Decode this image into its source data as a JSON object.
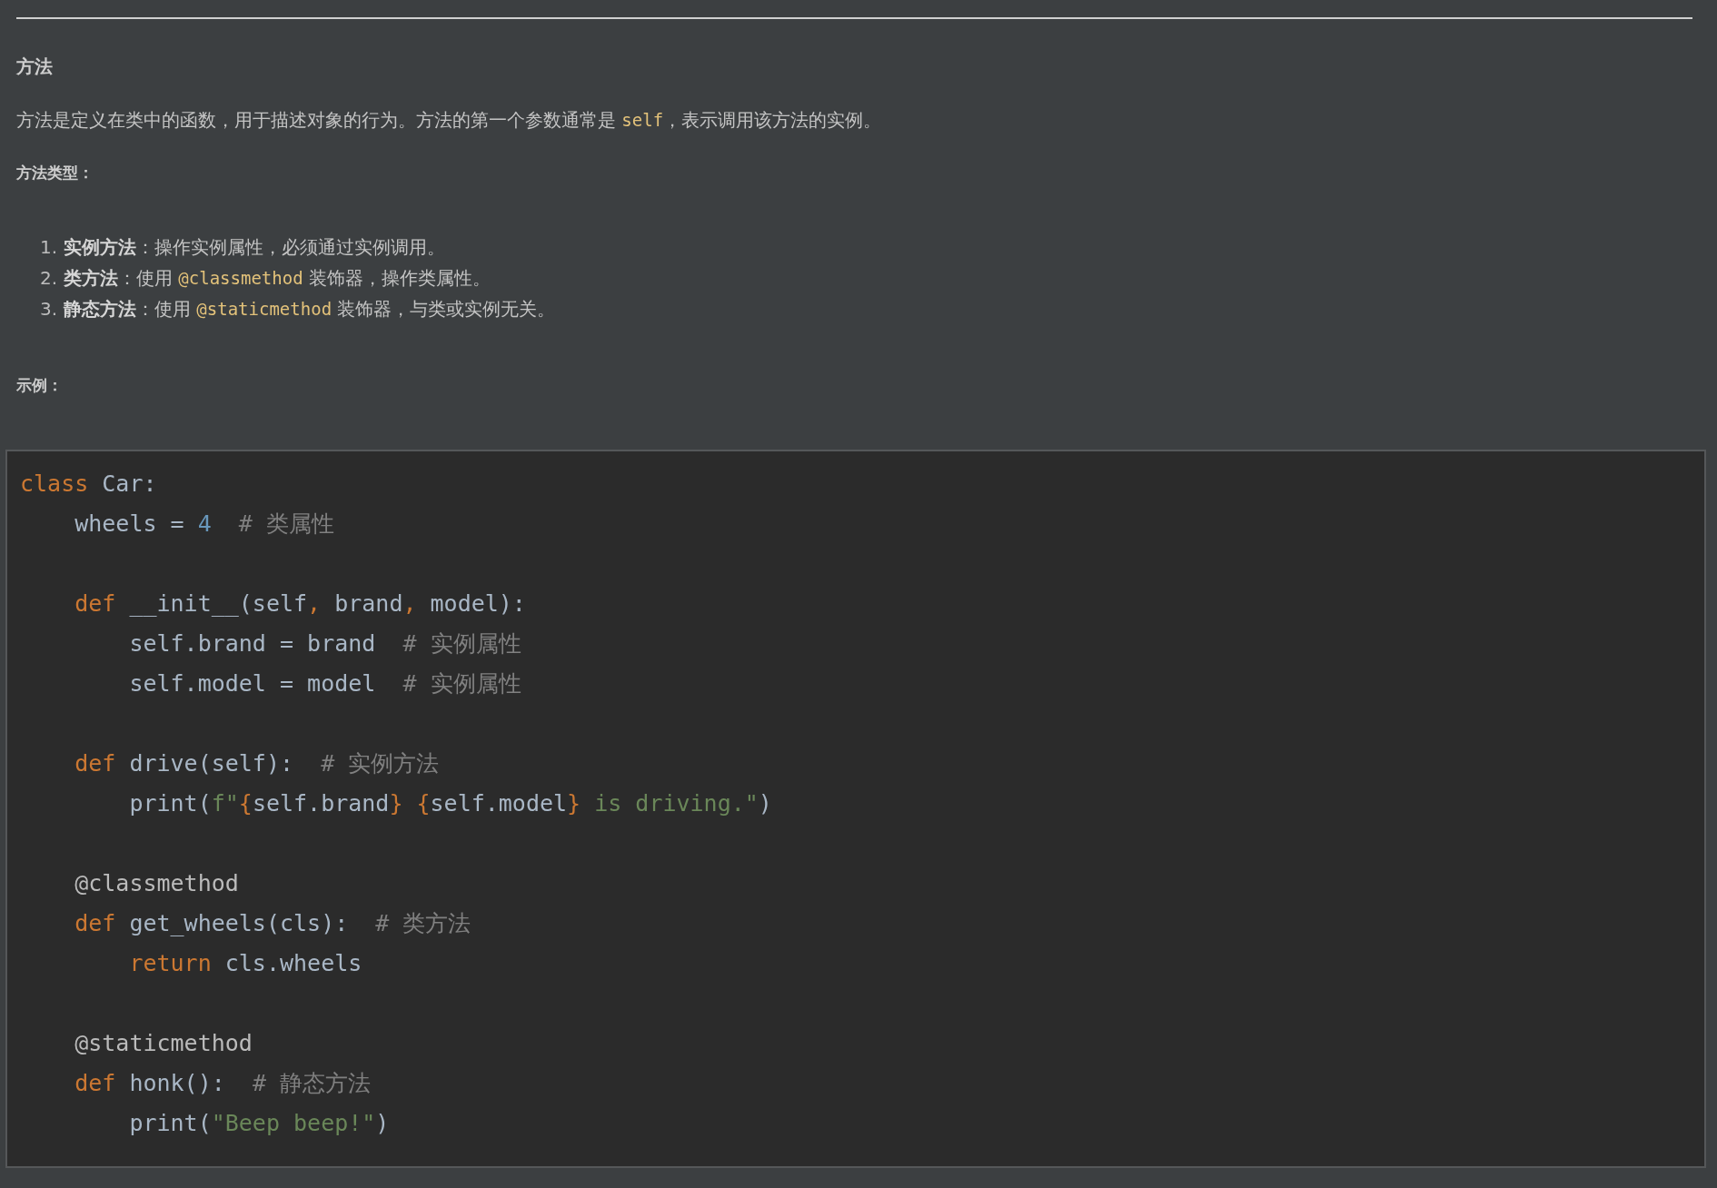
{
  "heading": "方法",
  "paragraph": [
    {
      "kind": "text",
      "text": "方法是定义在类中的函数，用于描述对象的行为。方法的第一个参数通常是 "
    },
    {
      "kind": "code",
      "text": "self"
    },
    {
      "kind": "text",
      "text": "，表示调用该方法的实例。"
    }
  ],
  "subheading": "方法类型：",
  "list": [
    {
      "number": "1.",
      "segments": [
        {
          "kind": "bold",
          "text": "实例方法"
        },
        {
          "kind": "text",
          "text": "：操作实例属性，必须通过实例调用。"
        }
      ]
    },
    {
      "number": "2.",
      "segments": [
        {
          "kind": "bold",
          "text": "类方法"
        },
        {
          "kind": "text",
          "text": "：使用 "
        },
        {
          "kind": "code",
          "text": "@classmethod"
        },
        {
          "kind": "text",
          "text": " 装饰器，操作类属性。"
        }
      ]
    },
    {
      "number": "3.",
      "segments": [
        {
          "kind": "bold",
          "text": "静态方法"
        },
        {
          "kind": "text",
          "text": "：使用 "
        },
        {
          "kind": "code",
          "text": "@staticmethod"
        },
        {
          "kind": "text",
          "text": " 装饰器，与类或实例无关。"
        }
      ]
    }
  ],
  "example_label": "示例：",
  "code_block": {
    "lines": [
      {
        "kind": "code",
        "tokens": [
          {
            "kind": "keyword",
            "text": "class"
          },
          {
            "kind": "plain",
            "text": " Car:"
          }
        ]
      },
      {
        "kind": "code",
        "tokens": [
          {
            "kind": "plain",
            "text": "    wheels = "
          },
          {
            "kind": "number",
            "text": "4"
          },
          {
            "kind": "comment",
            "text": "  # 类属性"
          }
        ]
      },
      {
        "kind": "blank"
      },
      {
        "kind": "code",
        "tokens": [
          {
            "kind": "keyword",
            "text": "    def"
          },
          {
            "kind": "plain",
            "text": " __init__(self"
          },
          {
            "kind": "keyword",
            "text": ","
          },
          {
            "kind": "plain",
            "text": " brand"
          },
          {
            "kind": "keyword",
            "text": ","
          },
          {
            "kind": "plain",
            "text": " model):"
          }
        ]
      },
      {
        "kind": "code",
        "tokens": [
          {
            "kind": "plain",
            "text": "        self.brand = brand"
          },
          {
            "kind": "comment",
            "text": "  # 实例属性"
          }
        ]
      },
      {
        "kind": "code",
        "tokens": [
          {
            "kind": "plain",
            "text": "        self.model = model"
          },
          {
            "kind": "comment",
            "text": "  # 实例属性"
          }
        ]
      },
      {
        "kind": "blank"
      },
      {
        "kind": "code",
        "tokens": [
          {
            "kind": "keyword",
            "text": "    def"
          },
          {
            "kind": "plain",
            "text": " drive(self):"
          },
          {
            "kind": "comment",
            "text": "  # 实例方法"
          }
        ]
      },
      {
        "kind": "code",
        "tokens": [
          {
            "kind": "plain",
            "text": "        print("
          },
          {
            "kind": "string",
            "text": "f\""
          },
          {
            "kind": "keyword",
            "text": "{"
          },
          {
            "kind": "plain",
            "text": "self.brand"
          },
          {
            "kind": "keyword",
            "text": "} {"
          },
          {
            "kind": "plain",
            "text": "self.model"
          },
          {
            "kind": "keyword",
            "text": "}"
          },
          {
            "kind": "string",
            "text": " is driving.\""
          },
          {
            "kind": "plain",
            "text": ")"
          }
        ]
      },
      {
        "kind": "blank"
      },
      {
        "kind": "code",
        "tokens": [
          {
            "kind": "decorator",
            "text": "    @classmethod"
          }
        ]
      },
      {
        "kind": "code",
        "tokens": [
          {
            "kind": "keyword",
            "text": "    def"
          },
          {
            "kind": "plain",
            "text": " get_wheels(cls):"
          },
          {
            "kind": "comment",
            "text": "  # 类方法"
          }
        ]
      },
      {
        "kind": "code",
        "tokens": [
          {
            "kind": "keyword",
            "text": "        return"
          },
          {
            "kind": "plain",
            "text": " cls.wheels"
          }
        ]
      },
      {
        "kind": "blank"
      },
      {
        "kind": "code",
        "tokens": [
          {
            "kind": "decorator",
            "text": "    @staticmethod"
          }
        ]
      },
      {
        "kind": "code",
        "tokens": [
          {
            "kind": "keyword",
            "text": "    def"
          },
          {
            "kind": "plain",
            "text": " honk():"
          },
          {
            "kind": "comment",
            "text": "  # 静态方法"
          }
        ]
      },
      {
        "kind": "code",
        "tokens": [
          {
            "kind": "plain",
            "text": "        print("
          },
          {
            "kind": "string",
            "text": "\"Beep beep!\""
          },
          {
            "kind": "plain",
            "text": ")"
          }
        ]
      }
    ]
  }
}
